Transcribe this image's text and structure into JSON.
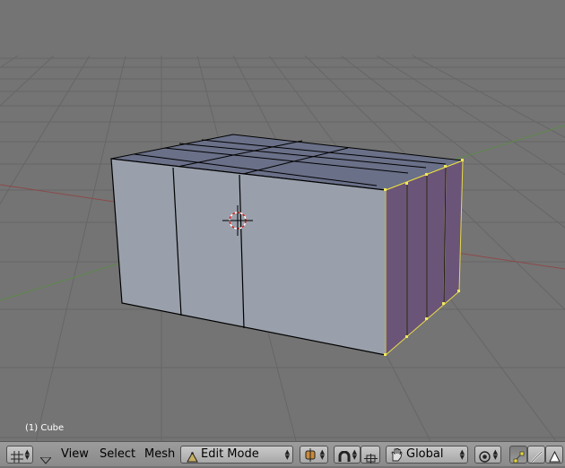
{
  "viewport": {
    "object_info": "(1) Cube",
    "mode": "edit",
    "colors": {
      "background": "#747474",
      "grid": "#646464",
      "x_axis": "#8c4a4a",
      "y_axis": "#5e8a4a",
      "face_front": "#99a0ab",
      "face_top": "#6a7088",
      "face_selected": "#6a5578",
      "edge": "#000000",
      "selected_edge": "#e6d94a",
      "cursor": "#d02020"
    }
  },
  "header": {
    "editor_type_icon": "grid-editor-icon",
    "menus": [
      "View",
      "Select",
      "Mesh"
    ],
    "mode_dropdown": {
      "label": "Edit Mode",
      "icon": "edit-mode-icon"
    },
    "pivot_icon": "pivot-icon",
    "magnet_icon": "magnet-icon",
    "manipulator_icon": "manipulator-icon",
    "hand_icon": "hand-icon",
    "orientation_dropdown": {
      "label": "Global"
    },
    "proportional_icon": "proportional-icon",
    "select_modes": [
      "vertex-select-icon",
      "edge-select-icon",
      "face-select-icon"
    ]
  }
}
